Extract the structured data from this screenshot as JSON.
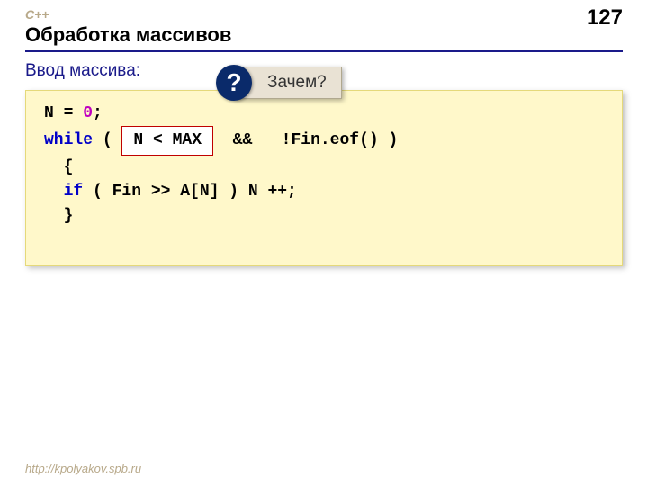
{
  "header": {
    "lang": "C++",
    "page_number": "127",
    "title": "Обработка массивов"
  },
  "subtitle": "Ввод массива:",
  "callout": {
    "icon": "?",
    "text": "Зачем?"
  },
  "code": {
    "l1_a": "N",
    "l1_b": " = ",
    "l1_c": "0",
    "l1_d": ";",
    "l2_a": "while",
    "l2_b": " ( ",
    "l2_box": "N < MAX",
    "l2_c": "  &&   !Fin.eof() )",
    "l3": "  {",
    "l4_a": "  ",
    "l4_b": "if",
    "l4_c": " ( Fin >> A[N] ) N ++;",
    "l5": "  }"
  },
  "footer": "http://kpolyakov.spb.ru"
}
